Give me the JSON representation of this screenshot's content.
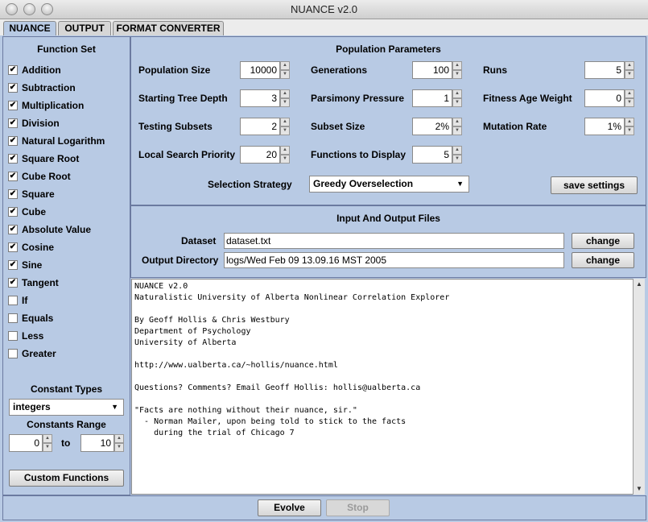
{
  "window": {
    "title": "NUANCE v2.0"
  },
  "tabs": [
    {
      "label": "NUANCE"
    },
    {
      "label": "OUTPUT"
    },
    {
      "label": "FORMAT CONVERTER"
    }
  ],
  "function_set": {
    "title": "Function Set",
    "items": [
      {
        "label": "Addition",
        "checked": true
      },
      {
        "label": "Subtraction",
        "checked": true
      },
      {
        "label": "Multiplication",
        "checked": true
      },
      {
        "label": "Division",
        "checked": true
      },
      {
        "label": "Natural Logarithm",
        "checked": true
      },
      {
        "label": "Square Root",
        "checked": true
      },
      {
        "label": "Cube Root",
        "checked": true
      },
      {
        "label": "Square",
        "checked": true
      },
      {
        "label": "Cube",
        "checked": true
      },
      {
        "label": "Absolute Value",
        "checked": true
      },
      {
        "label": "Cosine",
        "checked": true
      },
      {
        "label": "Sine",
        "checked": true
      },
      {
        "label": "Tangent",
        "checked": true
      },
      {
        "label": "If",
        "checked": false
      },
      {
        "label": "Equals",
        "checked": false
      },
      {
        "label": "Less",
        "checked": false
      },
      {
        "label": "Greater",
        "checked": false
      }
    ]
  },
  "constants": {
    "types_title": "Constant Types",
    "type_value": "integers",
    "range_title": "Constants Range",
    "range_from": "0",
    "range_to_label": "to",
    "range_to": "10"
  },
  "custom_functions_label": "Custom Functions",
  "population": {
    "title": "Population Parameters",
    "population_size_label": "Population Size",
    "population_size": "10000",
    "generations_label": "Generations",
    "generations": "100",
    "runs_label": "Runs",
    "runs": "5",
    "tree_depth_label": "Starting Tree Depth",
    "tree_depth": "3",
    "parsimony_label": "Parsimony Pressure",
    "parsimony": "1",
    "fitness_age_label": "Fitness Age Weight",
    "fitness_age": "0",
    "testing_subsets_label": "Testing Subsets",
    "testing_subsets": "2",
    "subset_size_label": "Subset Size",
    "subset_size": "2%",
    "mutation_rate_label": "Mutation Rate",
    "mutation_rate": "1%",
    "local_search_label": "Local Search Priority",
    "local_search": "20",
    "functions_display_label": "Functions to Display",
    "functions_display": "5",
    "selection_label": "Selection Strategy",
    "selection_value": "Greedy Overselection",
    "save_label": "save settings"
  },
  "files": {
    "title": "Input And Output Files",
    "dataset_label": "Dataset",
    "dataset_value": "dataset.txt",
    "output_label": "Output Directory",
    "output_value": "logs/Wed Feb 09 13.09.16 MST 2005",
    "change_label": "change"
  },
  "log_text": "NUANCE v2.0\nNaturalistic University of Alberta Nonlinear Correlation Explorer\n\nBy Geoff Hollis & Chris Westbury\nDepartment of Psychology\nUniversity of Alberta\n\nhttp://www.ualberta.ca/~hollis/nuance.html\n\nQuestions? Comments? Email Geoff Hollis: hollis@ualberta.ca\n\n\"Facts are nothing without their nuance, sir.\"\n  - Norman Mailer, upon being told to stick to the facts\n    during the trial of Chicago 7",
  "bottom": {
    "evolve_label": "Evolve",
    "stop_label": "Stop"
  }
}
